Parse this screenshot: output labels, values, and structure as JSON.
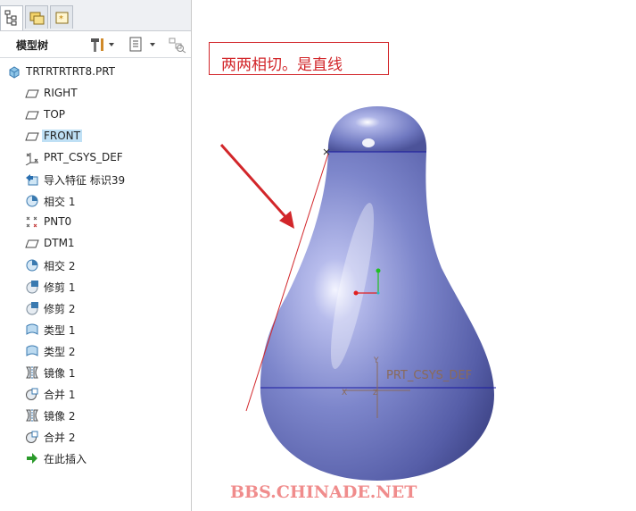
{
  "panel_tabs": [
    {
      "name": "model-tree-tab",
      "icon": "model-tree-icon",
      "active": true
    },
    {
      "name": "folder-browser-tab",
      "icon": "folder-icon",
      "active": false
    },
    {
      "name": "favorites-tab",
      "icon": "star-icon",
      "active": false
    }
  ],
  "tree_title": "模型树",
  "tree_items": [
    {
      "label": "TRTRTRTRT8.PRT",
      "icon": "part-icon"
    },
    {
      "label": "RIGHT",
      "icon": "datum-plane-icon"
    },
    {
      "label": "TOP",
      "icon": "datum-plane-icon"
    },
    {
      "label": "FRONT",
      "icon": "datum-plane-icon",
      "selected": true
    },
    {
      "label": "PRT_CSYS_DEF",
      "icon": "coordinate-system-icon"
    },
    {
      "label": "导入特征 标识39",
      "icon": "import-feature-icon"
    },
    {
      "label": "相交 1",
      "icon": "intersect-icon"
    },
    {
      "label": "PNT0",
      "icon": "datum-point-icon"
    },
    {
      "label": "DTM1",
      "icon": "datum-plane-icon"
    },
    {
      "label": "相交 2",
      "icon": "intersect-icon"
    },
    {
      "label": "修剪 1",
      "icon": "trim-icon"
    },
    {
      "label": "修剪 2",
      "icon": "trim-icon"
    },
    {
      "label": "类型 1",
      "icon": "style-surface-icon"
    },
    {
      "label": "类型 2",
      "icon": "style-surface-icon"
    },
    {
      "label": "镜像 1",
      "icon": "mirror-icon"
    },
    {
      "label": "合并 1",
      "icon": "merge-icon"
    },
    {
      "label": "镜像 2",
      "icon": "mirror-icon"
    },
    {
      "label": "合并 2",
      "icon": "merge-icon"
    },
    {
      "label": "在此插入",
      "icon": "insert-here-arrow-icon"
    }
  ],
  "annotation_text": "两两相切。是直线",
  "csys_label": "PRT_CSYS_DEF",
  "axis_labels": {
    "x": "X",
    "y": "Y",
    "z": "Z"
  },
  "watermark": "BBS.CHINADE.NET",
  "colors": {
    "selection": "#bfe0f5",
    "annotation_red": "#d2262a",
    "surface_blue": "#7b84c8",
    "datum_line": "#1a1aa0",
    "watermark": "#f08c8c"
  }
}
